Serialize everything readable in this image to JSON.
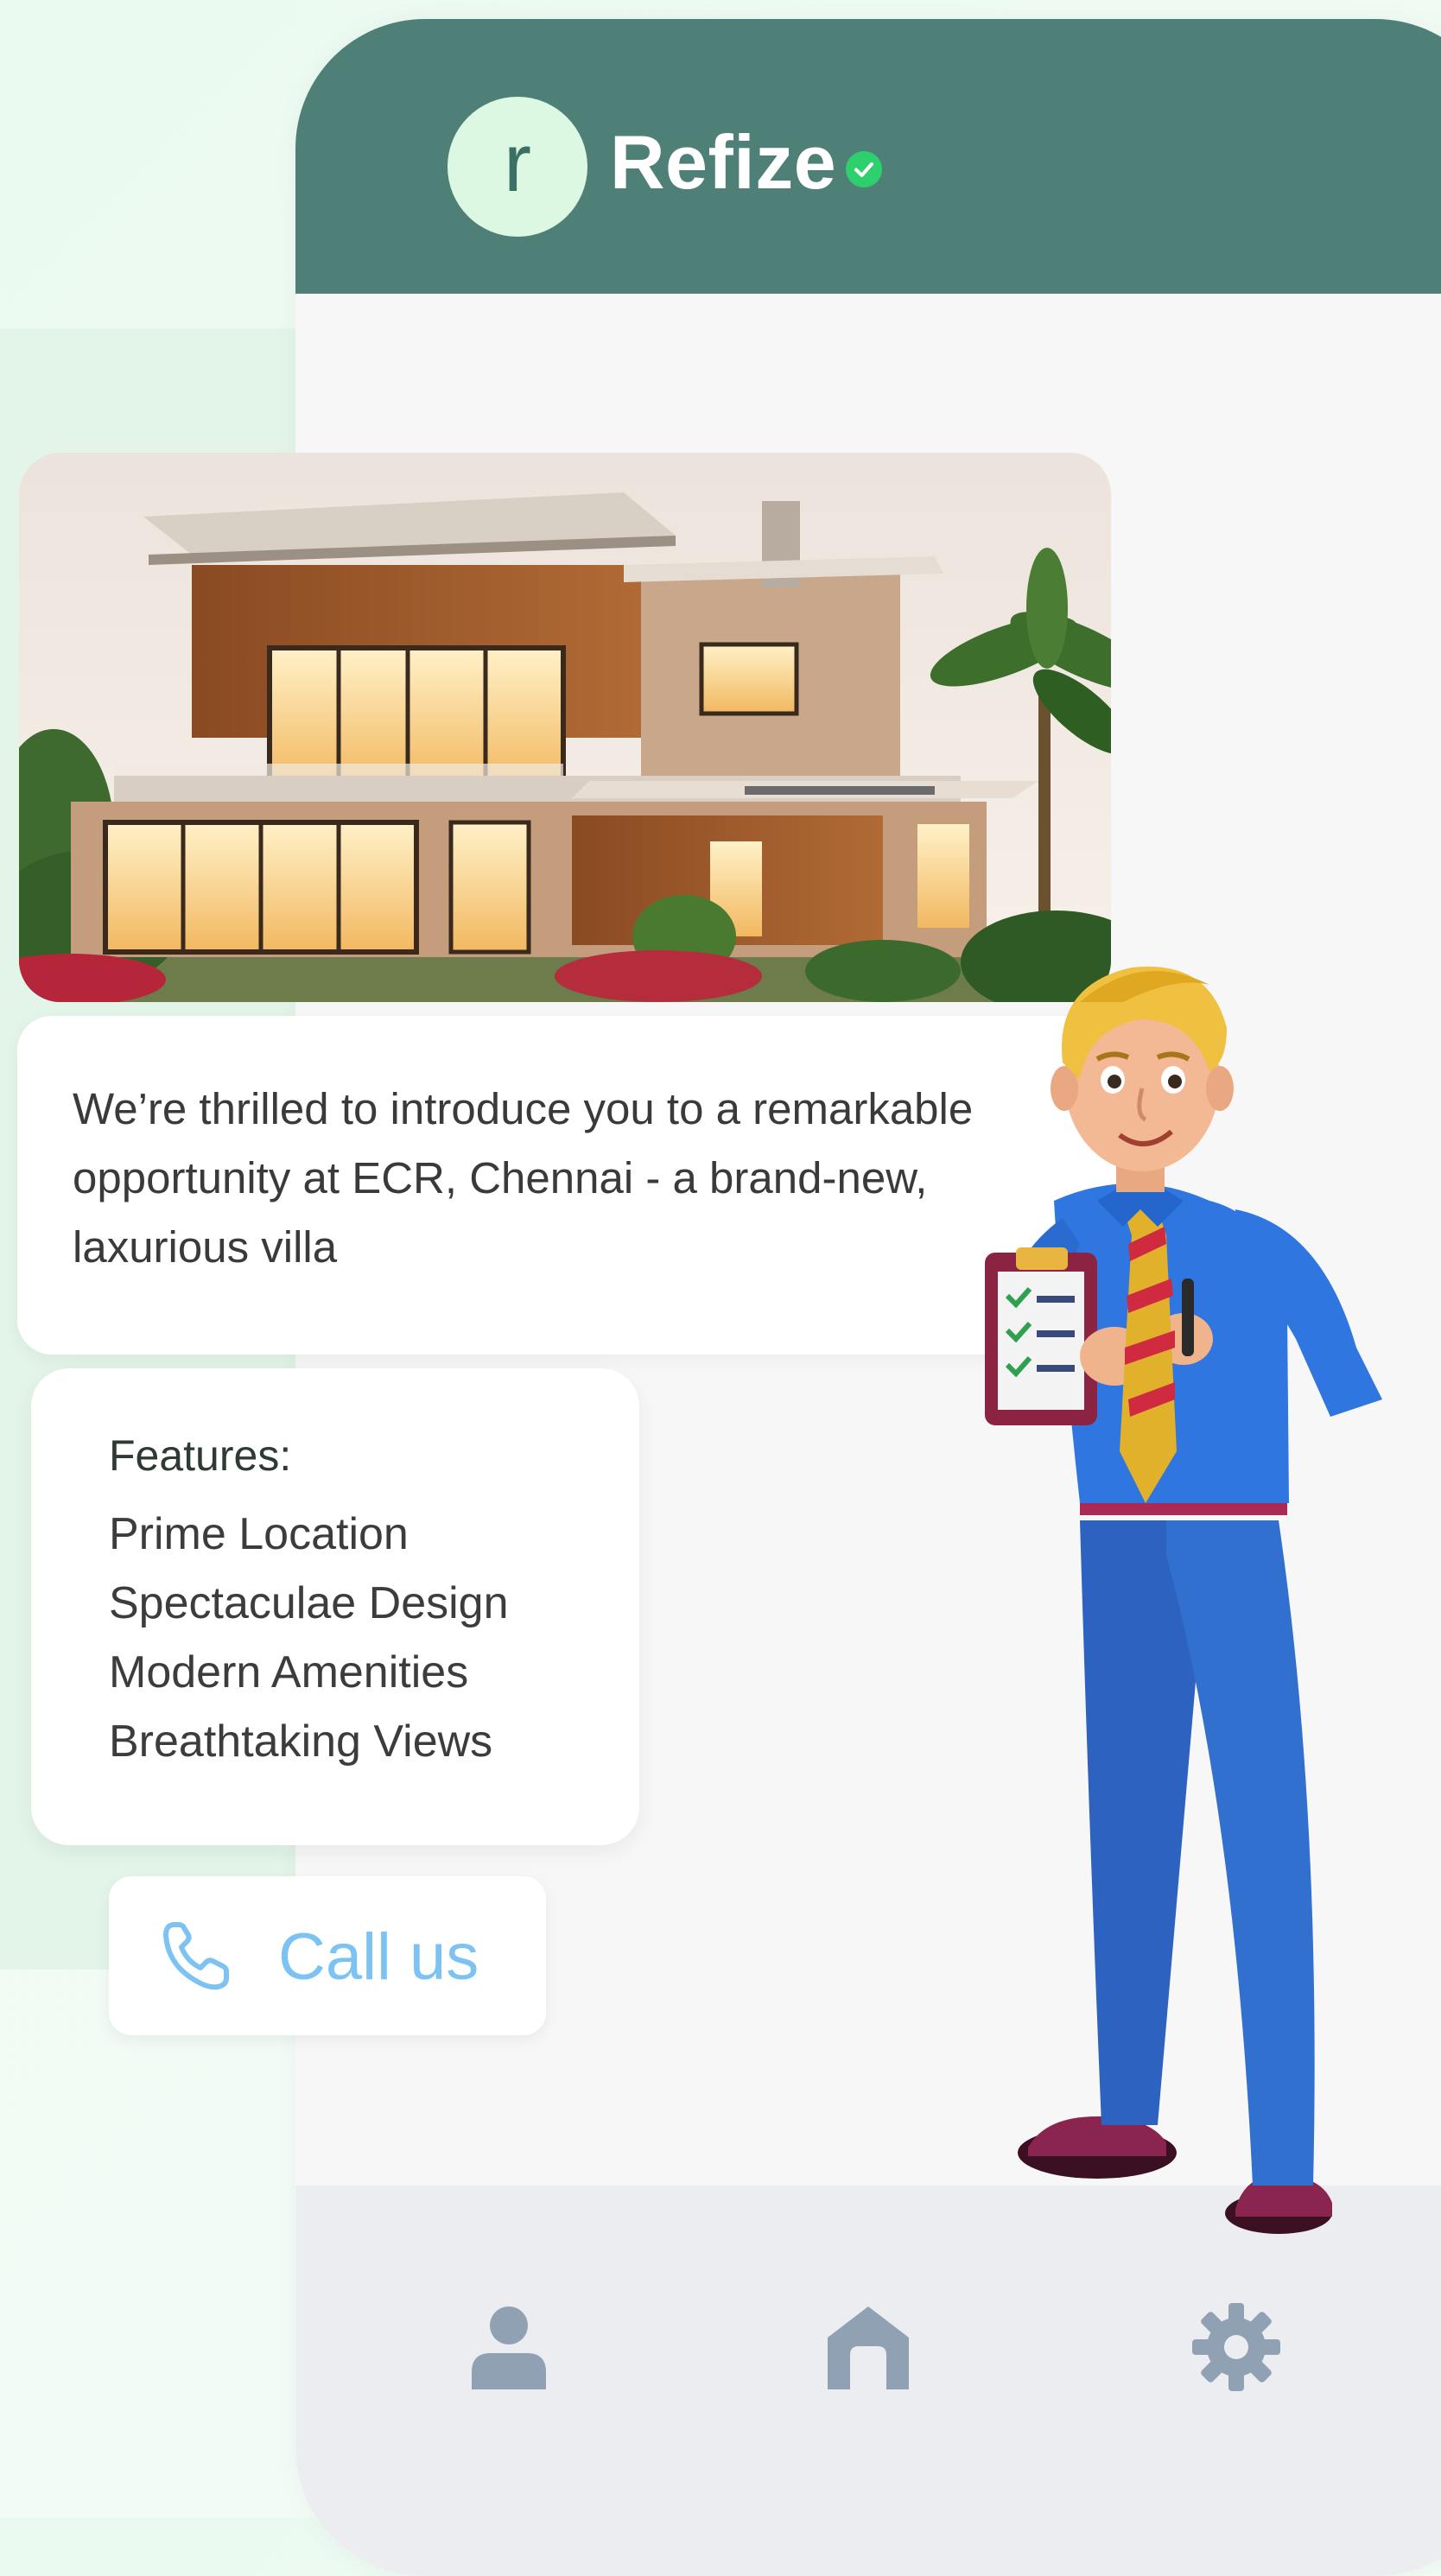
{
  "app": {
    "avatar_letter": "r",
    "name": "Refize"
  },
  "message": {
    "text": "We’re thrilled to introduce you to a remarkable opportunity at ECR, Chennai - a brand-new, laxurious villa"
  },
  "features": {
    "title": "Features:",
    "items": [
      "Prime Location",
      "Spectaculae Design",
      "Modern Amenities",
      "Breathtaking Views"
    ]
  },
  "cta": {
    "label": "Call us"
  },
  "nav": {
    "items": [
      "profile-icon",
      "home-icon",
      "settings-icon"
    ]
  },
  "colors": {
    "header": "#4f8077",
    "avatar_bg": "#dcf8e3",
    "verified": "#2ed06e",
    "call_text": "#7cc3f3",
    "nav_icon": "#8fa1b2"
  }
}
